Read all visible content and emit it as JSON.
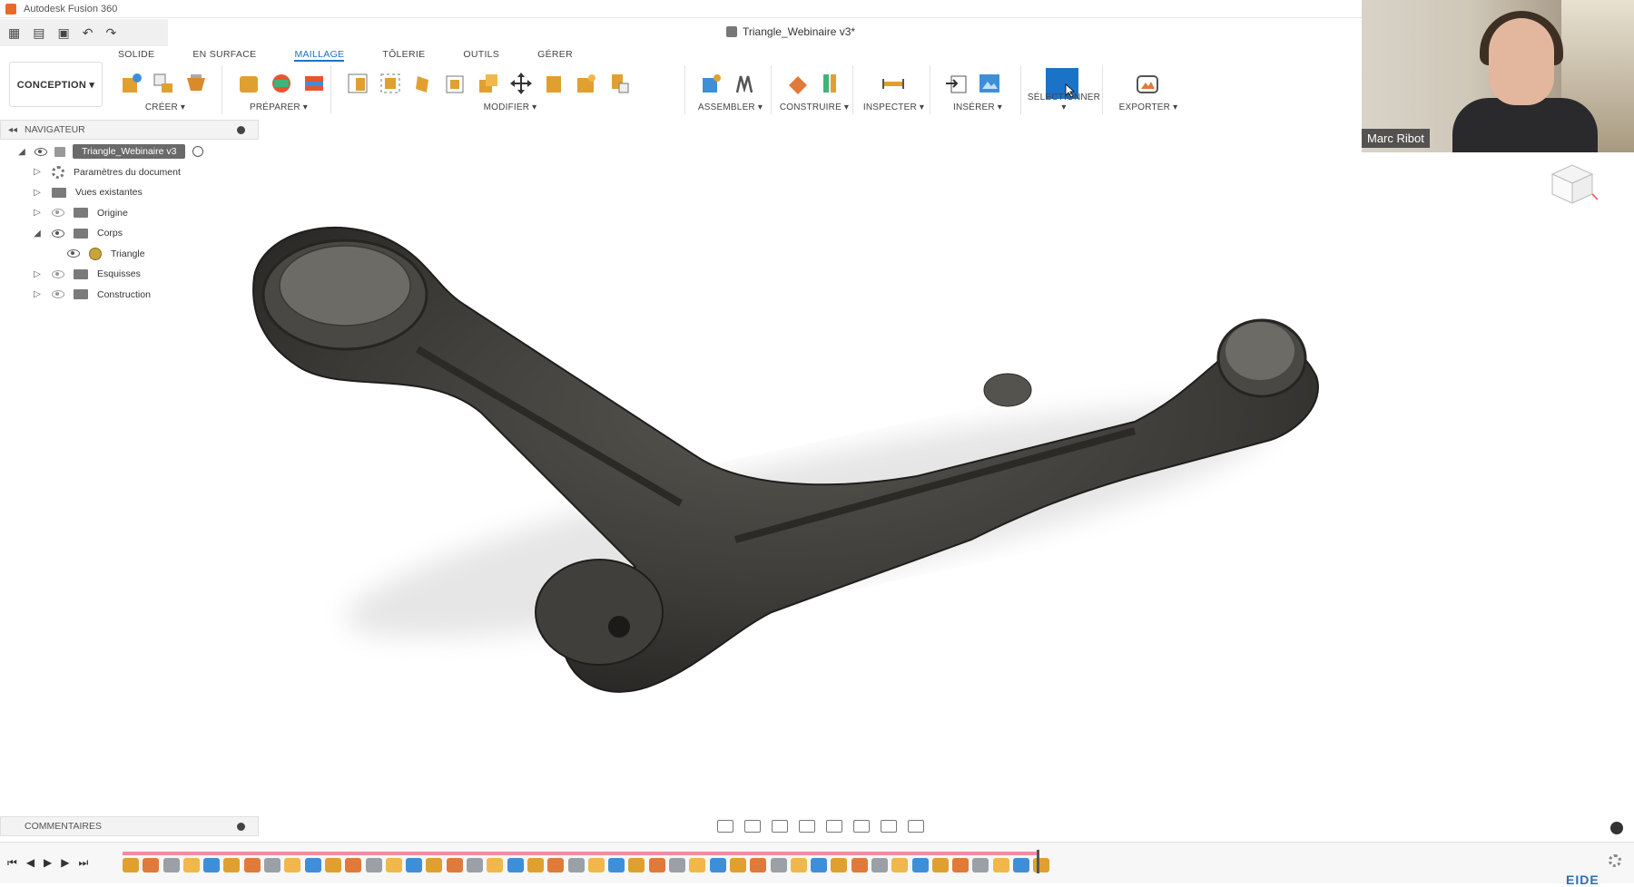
{
  "app": {
    "title": "Autodesk Fusion 360",
    "document_tab": "Triangle_Webinaire v3*"
  },
  "workspace": {
    "label": "CONCEPTION ▾"
  },
  "ribbon": {
    "tabs": [
      {
        "label": "SOLIDE",
        "active": false
      },
      {
        "label": "EN SURFACE",
        "active": false
      },
      {
        "label": "MAILLAGE",
        "active": true
      },
      {
        "label": "TÔLERIE",
        "active": false
      },
      {
        "label": "OUTILS",
        "active": false
      },
      {
        "label": "GÉRER",
        "active": false
      }
    ],
    "groups": {
      "create": "CRÉER ▾",
      "prepare": "PRÉPARER ▾",
      "modify": "MODIFIER ▾",
      "assemble": "ASSEMBLER ▾",
      "construct": "CONSTRUIRE ▾",
      "inspect": "INSPECTER ▾",
      "insert": "INSÉRER ▾",
      "select": "SÉLECTIONNER ▾",
      "export": "EXPORTER ▾"
    }
  },
  "navigator": {
    "title": "NAVIGATEUR",
    "root": "Triangle_Webinaire v3",
    "items": [
      {
        "label": "Paramètres du document"
      },
      {
        "label": "Vues existantes"
      },
      {
        "label": "Origine"
      },
      {
        "label": "Corps"
      },
      {
        "label": "Triangle"
      },
      {
        "label": "Esquisses"
      },
      {
        "label": "Construction"
      }
    ]
  },
  "comments": {
    "title": "COMMENTAIRES"
  },
  "webcam": {
    "name": "Marc Ribot"
  },
  "watermark": {
    "text": "EIDE"
  },
  "colors": {
    "accent": "#1a73c7",
    "timeline": "#f28ca0",
    "model": "#3b3a37"
  },
  "timeline": {
    "item_count": 46
  }
}
